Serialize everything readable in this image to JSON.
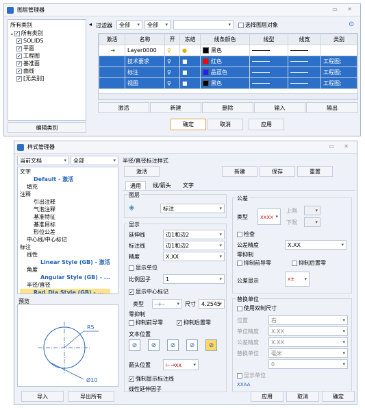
{
  "layer_manager": {
    "title": "图层管理器",
    "left_header": "所有类别",
    "tree": {
      "root": "所有类别",
      "children": [
        "SOLIDS",
        "平面",
        "工程图",
        "基准面",
        "曲线",
        "[无类别]"
      ]
    },
    "edit_category": "编辑类别",
    "filter_label": "过滤器",
    "filter_value1": "全部",
    "filter_value2": "全部",
    "select_layer_object": "选择图层对象",
    "columns": [
      "激活",
      "名称",
      "开",
      "冻结",
      "线条颜色",
      "线型",
      "线宽",
      "类别"
    ],
    "rows": [
      {
        "name": "Layer0000",
        "color_name": "黑色",
        "color_hex": "#000000",
        "category": "",
        "active": true
      },
      {
        "name": "技术要求",
        "color_name": "红色",
        "color_hex": "#ff0000",
        "category": "工程图;"
      },
      {
        "name": "标注",
        "color_name": "品蓝色",
        "color_hex": "#2020ff",
        "category": "工程图;"
      },
      {
        "name": "视图",
        "color_name": "黑色",
        "color_hex": "#000000",
        "category": "工程图;"
      }
    ],
    "actions": [
      "激活",
      "新建",
      "删除",
      "输入",
      "输出"
    ],
    "ok": "确定",
    "cancel": "取消",
    "apply": "应用"
  },
  "style_manager": {
    "title": "样式管理器",
    "doc_scope": "当前文档",
    "doc_filter": "全部",
    "tree": [
      {
        "text": "文字",
        "indent": 0
      },
      {
        "text": "Default - 激活",
        "indent": 2,
        "cls": "blue"
      },
      {
        "text": "填充",
        "indent": 1
      },
      {
        "text": "注释",
        "indent": 0
      },
      {
        "text": "引出注释",
        "indent": 2
      },
      {
        "text": "气泡注释",
        "indent": 2
      },
      {
        "text": "基准特征",
        "indent": 2
      },
      {
        "text": "基准目标",
        "indent": 2
      },
      {
        "text": "形位公差",
        "indent": 2
      },
      {
        "text": "中心线/中心标记",
        "indent": 1
      },
      {
        "text": "标注",
        "indent": 0
      },
      {
        "text": "线性",
        "indent": 1
      },
      {
        "text": "Linear Style (GB) - 激活",
        "indent": 3,
        "cls": "blue"
      },
      {
        "text": "角度",
        "indent": 1
      },
      {
        "text": "Angular Style (GB) - ...",
        "indent": 3,
        "cls": "blue"
      },
      {
        "text": "半径/直径",
        "indent": 1
      },
      {
        "text": "Rad_Dia Style (GB) - ...",
        "indent": 2,
        "cls": "blue hl"
      },
      {
        "text": "弧长",
        "indent": 1
      },
      {
        "text": "倒角",
        "indent": 1
      },
      {
        "text": "孔标注",
        "indent": 1
      },
      {
        "text": "坐标",
        "indent": 1
      }
    ],
    "preview_label": "预览",
    "preview_r": "R5",
    "preview_d": "Ø10",
    "style_name_header": "半径/直径标注样式",
    "activate": "激活",
    "new": "新建",
    "save": "保存",
    "reset": "重置",
    "tabs": [
      "通用",
      "线/箭头",
      "文字"
    ],
    "layer_label": "图层",
    "layer_value": "标注",
    "display_label": "显示",
    "ext_line_label": "延伸线",
    "ext_line_value": "边1和边2",
    "dim_line_label": "标注线",
    "dim_line_value": "边1和边2",
    "precision_label": "精度",
    "precision_value": "X.XX",
    "show_unit": "显示单位",
    "scale_label": "比例因子",
    "scale_value": "1",
    "show_center_mark": "显示中心标记",
    "type_label": "类型",
    "size_label": "尺寸",
    "size_value": "4.2545",
    "zero_suppress_label": "零抑制",
    "suppress_leading": "抑制前导零",
    "suppress_trailing": "抑制后置零",
    "text_pos_label": "文本位置",
    "arrow_pos_label": "箭头位置",
    "force_show_dim": "强制显示标注线",
    "ext_length_label": "线性延伸因子",
    "tolerance_label": "公差",
    "tol_type_label": "类型",
    "tol_type_value": "xxxx",
    "upper_label": "上限",
    "lower_label": "下限",
    "check_label": "检查",
    "tol_precision_label": "公差精度",
    "tol_precision_value": "X.XX",
    "zero_suppress2": "零抑制",
    "suppress_leading2": "抑制前导零",
    "suppress_trailing2": "抑制后置零",
    "tol_display_label": "公差显示",
    "alt_unit_label": "替换单位",
    "use_dual": "使用双制尺寸",
    "position_label": "位置",
    "position_value": "右",
    "unit_precision_label": "单位精度",
    "unit_precision_value": "X.XX",
    "tol_precision2_label": "公差精度",
    "tol_precision2_value": "X.XX",
    "alt_unit2_label": "替换单位",
    "alt_unit2_value": "毫米",
    "alt_zero_value": "0",
    "show_unit2": "显示单位",
    "xxaa": "XXAA",
    "import": "导入",
    "export_all": "导出所有",
    "apply": "应用",
    "cancel": "取消",
    "ok": "确定"
  }
}
